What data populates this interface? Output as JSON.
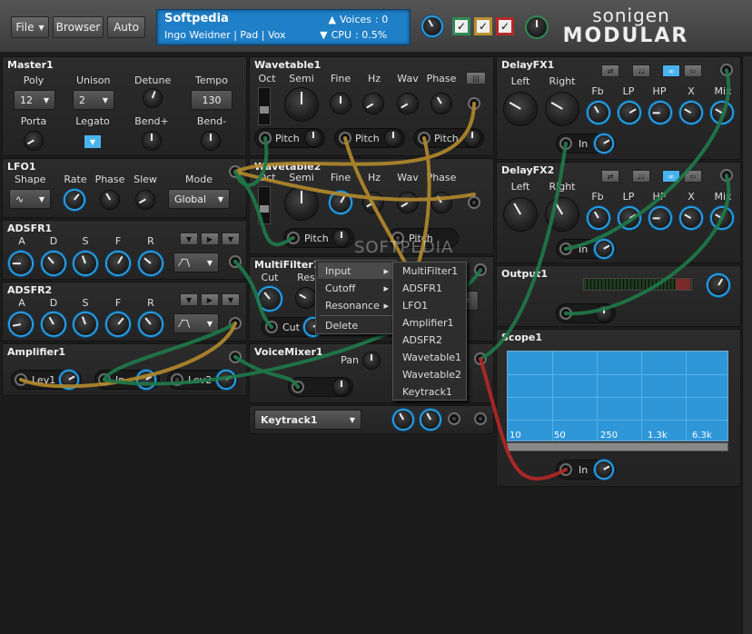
{
  "toolbar": {
    "file": "File",
    "browser": "Browser",
    "auto": "Auto"
  },
  "display": {
    "patch": "Softpedia",
    "info": "Ingo Weidner | Pad | Vox",
    "voices_label": "Voices",
    "voices_value": ": 0",
    "cpu_label": "CPU",
    "cpu_value": ": 0.5%"
  },
  "brand": {
    "line1": "sonigen",
    "line2": "MODULAR"
  },
  "master": {
    "title": "Master1",
    "poly_label": "Poly",
    "poly_value": "12",
    "unison_label": "Unison",
    "unison_value": "2",
    "detune_label": "Detune",
    "tempo_label": "Tempo",
    "tempo_value": "130",
    "porta_label": "Porta",
    "legato_label": "Legato",
    "bendp_label": "Bend+",
    "bendm_label": "Bend-"
  },
  "lfo": {
    "title": "LFO1",
    "shape_label": "Shape",
    "rate_label": "Rate",
    "phase_label": "Phase",
    "slew_label": "Slew",
    "mode_label": "Mode",
    "mode_value": "Global"
  },
  "adsfr1": {
    "title": "ADSFR1",
    "a": "A",
    "d": "D",
    "s": "S",
    "f": "F",
    "r": "R"
  },
  "adsfr2": {
    "title": "ADSFR2",
    "a": "A",
    "d": "D",
    "s": "S",
    "f": "F",
    "r": "R"
  },
  "amplifier": {
    "title": "Amplifier1",
    "lev1": "Lev1",
    "in": "In",
    "lev2": "Lev2"
  },
  "wavetable1": {
    "title": "Wavetable1",
    "oct": "Oct",
    "semi": "Semi",
    "fine": "Fine",
    "hz": "Hz",
    "wav": "Wav",
    "phase": "Phase",
    "pitch": "Pitch"
  },
  "wavetable2": {
    "title": "Wavetable2",
    "oct": "Oct",
    "semi": "Semi",
    "fine": "Fine",
    "hz": "Hz",
    "wav": "Wav",
    "phase": "Phase",
    "pitch": "Pitch"
  },
  "multifilter": {
    "title": "MultiFilter1",
    "cut": "Cut",
    "res": "Res",
    "cut_mod": "Cut"
  },
  "voicemixer": {
    "title": "VoiceMixer1",
    "pan": "Pan"
  },
  "keytrack": {
    "value": "Keytrack1"
  },
  "delay1": {
    "title": "DelayFX1",
    "left": "Left",
    "right": "Right",
    "fb": "Fb",
    "lp": "LP",
    "hp": "HP",
    "x": "X",
    "mix": "Mix",
    "in": "In"
  },
  "delay2": {
    "title": "DelayFX2",
    "left": "Left",
    "right": "Right",
    "fb": "Fb",
    "lp": "LP",
    "hp": "HP",
    "x": "X",
    "mix": "Mix",
    "in": "In"
  },
  "output": {
    "title": "Output1"
  },
  "scope": {
    "title": "Scope1",
    "in": "In",
    "ticks": [
      "10",
      "50",
      "250",
      "1.3k",
      "6.3k"
    ]
  },
  "context_menu": {
    "items": [
      "Input",
      "Cutoff",
      "Resonance",
      "Delete"
    ],
    "submenu": [
      "MultiFilter1",
      "ADSFR1",
      "LFO1",
      "Amplifier1",
      "ADSFR2",
      "Wavetable1",
      "Wavetable2",
      "Keytrack1"
    ]
  },
  "watermark": "SOFTPEDIA",
  "colors": {
    "accent": "#2a9de0",
    "wire_green": "#1f7a4a",
    "wire_gold": "#b38a2c",
    "wire_red": "#b52828"
  }
}
